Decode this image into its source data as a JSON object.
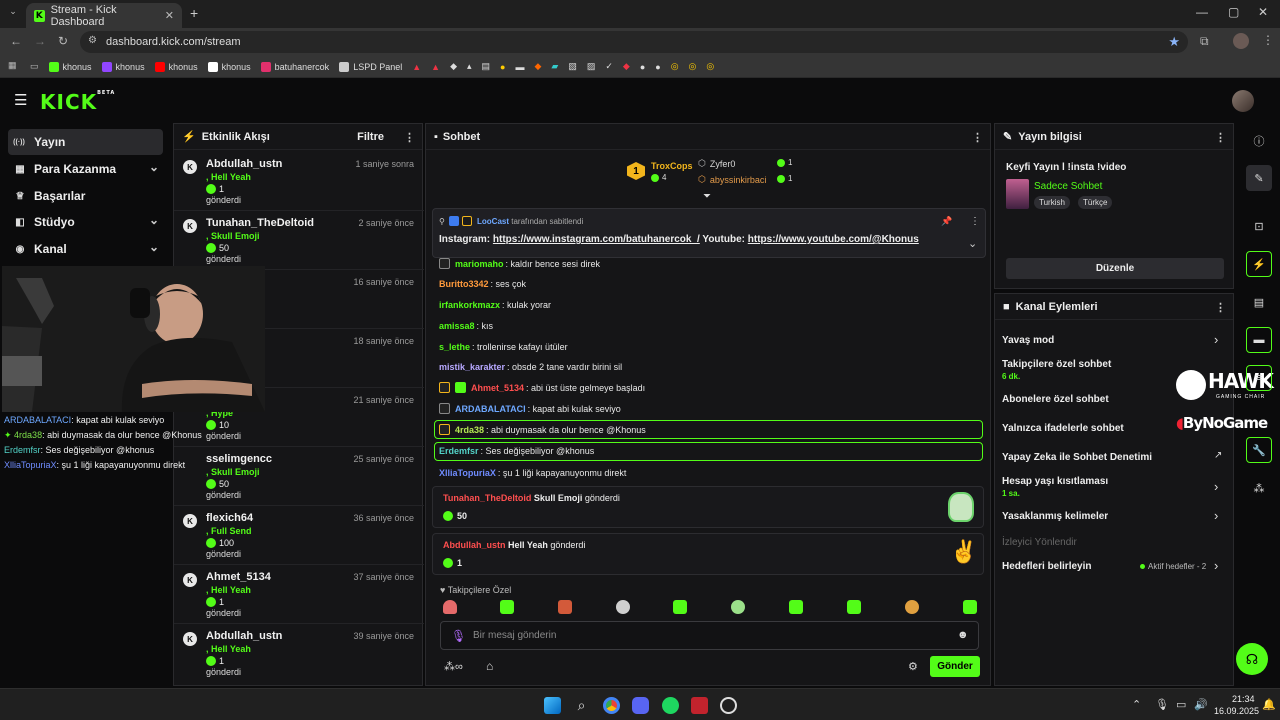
{
  "browser": {
    "tab_title": "Stream - Kick Dashboard",
    "url": "dashboard.kick.com/stream",
    "bookmarks": [
      {
        "label": "khonus",
        "color": "#53fc18"
      },
      {
        "label": "khonus",
        "color": "#9146ff"
      },
      {
        "label": "khonus",
        "color": "#ff0000"
      },
      {
        "label": "khonus",
        "color": "#ffffff"
      },
      {
        "label": "batuhanercok",
        "color": "#e1306c"
      },
      {
        "label": "LSPD Panel",
        "color": "#cccccc"
      }
    ]
  },
  "kick": {
    "logo": "KICK",
    "logo_tag": "BETA"
  },
  "sidebar": {
    "items": [
      {
        "label": "Yayın",
        "icon": "broadcast-icon",
        "glyph": "((·))",
        "active": true,
        "has_chevron": false
      },
      {
        "label": "Para Kazanma",
        "icon": "money-icon",
        "glyph": "▦",
        "active": false,
        "has_chevron": true
      },
      {
        "label": "Başarılar",
        "icon": "trophy-icon",
        "glyph": "🏆",
        "active": false,
        "has_chevron": false
      },
      {
        "label": "Stüdyo",
        "icon": "studio-icon",
        "glyph": "◧",
        "active": false,
        "has_chevron": true
      },
      {
        "label": "Kanal",
        "icon": "channel-icon",
        "glyph": "◉",
        "active": false,
        "has_chevron": true
      }
    ]
  },
  "activity": {
    "title": "Etkinlik Akışı",
    "filter_label": "Filtre",
    "sent_label": "gönderdi",
    "items": [
      {
        "user": "Abdullah_ustn",
        "time": "1 saniye sonra",
        "gift": "Hell Yeah",
        "amount": "1"
      },
      {
        "user": "Tunahan_TheDeltoid",
        "time": "2 saniye önce",
        "gift": "Skull Emoji",
        "amount": "50"
      },
      {
        "user": "",
        "time": "16 saniye önce",
        "gift": "",
        "amount": ""
      },
      {
        "user": "",
        "time": "18 saniye önce",
        "gift": "",
        "amount": ""
      },
      {
        "user": "",
        "time": "21 saniye önce",
        "gift": "Hype",
        "amount": "10"
      },
      {
        "user": "sselimgencc",
        "time": "25 saniye önce",
        "gift": "Skull Emoji",
        "amount": "50"
      },
      {
        "user": "flexich64",
        "time": "36 saniye önce",
        "gift": "Full Send",
        "amount": "100"
      },
      {
        "user": "Ahmet_5134",
        "time": "37 saniye önce",
        "gift": "Hell Yeah",
        "amount": "1"
      },
      {
        "user": "Abdullah_ustn",
        "time": "39 saniye önce",
        "gift": "Hell Yeah",
        "amount": "1"
      }
    ]
  },
  "stream_overlay_chat": [
    {
      "user": "ARDABALATACI",
      "text": ": kapat abi kulak seviyo",
      "color": "#6ea8ff"
    },
    {
      "user": "4rda38",
      "text": ": abi duymasak da olur bence @Khonus",
      "color": "#7ee04a"
    },
    {
      "user": "Erdemfsr",
      "text": ": Ses değişebiliyor @khonus",
      "color": "#53d3c8"
    },
    {
      "user": "XlliaTopuriaX",
      "text": ": şu 1 liği kapayanuyonmu direkt",
      "color": "#6f8cff"
    }
  ],
  "chat": {
    "title": "Sohbet",
    "leaders": {
      "first": {
        "user": "TroxCops",
        "count": "4"
      },
      "second": {
        "user": "Zyfer0",
        "count": "1"
      },
      "third": {
        "user": "abyssinkirbaci",
        "count": "1"
      }
    },
    "pinned": {
      "author": "LooCast",
      "suffix": "tarafından sabitlendi",
      "text_prefix": "Instagram: ",
      "link1": "https://www.instagram.com/batuhanercok_/",
      "middle": " Youtube: ",
      "link2": "https://www.youtube.com/@Khonus"
    },
    "messages": [
      {
        "user": "mariomaho",
        "text": ": kaldır bence sesi direk",
        "color": "#53fc18"
      },
      {
        "user": "Buritto3342",
        "text": ": ses çok",
        "color": "#ff9a3c"
      },
      {
        "user": "irfankorkmazx",
        "text": ": kulak yorar",
        "color": "#53fc18"
      },
      {
        "user": "amissa8",
        "text": ": kıs",
        "color": "#53fc18"
      },
      {
        "user": "s_lethe",
        "text": ": trollenirse kafayı ütüler",
        "color": "#53fc18"
      },
      {
        "user": "mistik_karakter",
        "text": ": obsde 2 tane vardır birini sil",
        "color": "#b7a8ff"
      },
      {
        "user": "Ahmet_5134",
        "text": ": abi üst üste gelmeye başladı",
        "color": "#ff4f4f"
      },
      {
        "user": "ARDABALATACI",
        "text": ": kapat abi kulak seviyo",
        "color": "#6ea8ff"
      },
      {
        "user": "4rda38",
        "text": ": abi duymasak da olur bence @Khonus",
        "color": "#b4e854"
      },
      {
        "user": "Erdemfsr",
        "text": ": Ses değişebiliyor @khonus",
        "color": "#53d3c8"
      },
      {
        "user": "XlliaTopuriaX",
        "text": ": şu 1 liği kapayanuyonmu direkt",
        "color": "#6f8cff"
      }
    ],
    "gifts": [
      {
        "user": "Tunahan_TheDeltoid",
        "gift": "Skull Emoji",
        "verb": "gönderdi",
        "amount": "50"
      },
      {
        "user": "Abdullah_ustn",
        "gift": "Hell Yeah",
        "verb": "gönderdi",
        "amount": "1"
      }
    ],
    "followers_only": "Takipçilere Özel",
    "input_placeholder": "Bir mesaj gönderin",
    "send_label": "Gönder"
  },
  "stream_info": {
    "title": "Yayın bilgisi",
    "stream_title": "Keyfi Yayın l !insta !video",
    "category": "Sadece Sohbet",
    "tags": [
      "Turkish",
      "Türkçe"
    ],
    "edit_label": "Düzenle"
  },
  "channel_actions": {
    "title": "Kanal Eylemleri",
    "items": [
      {
        "label": "Yavaş mod",
        "sub": "",
        "arrow": "›"
      },
      {
        "label": "Takipçilere özel sohbet",
        "sub": "6 dk.",
        "arrow": ""
      },
      {
        "label": "Abonelere özel sohbet",
        "sub": "",
        "arrow": ""
      },
      {
        "label": "Yalnızca ifadelerle sohbet",
        "sub": "",
        "arrow": ""
      },
      {
        "label": "Yapay Zeka ile Sohbet Denetimi",
        "sub": "",
        "arrow": "↗"
      },
      {
        "label": "Hesap yaşı kısıtlaması",
        "sub": "1 sa.",
        "arrow": "›"
      },
      {
        "label": "Yasaklanmış kelimeler",
        "sub": "",
        "arrow": "›"
      },
      {
        "label": "İzleyici Yönlendir",
        "sub": "",
        "arrow": ""
      },
      {
        "label": "Hedefleri belirleyin",
        "sub": "",
        "arrow": "›"
      }
    ],
    "goals_status": "Aktif hedefler - 2"
  },
  "sponsors": {
    "primary": "HAWK",
    "primary_sub": "GAMING CHAIR",
    "secondary": "ByNoGame"
  },
  "taskbar": {
    "time": "21:34",
    "date": "16.09.2025"
  }
}
